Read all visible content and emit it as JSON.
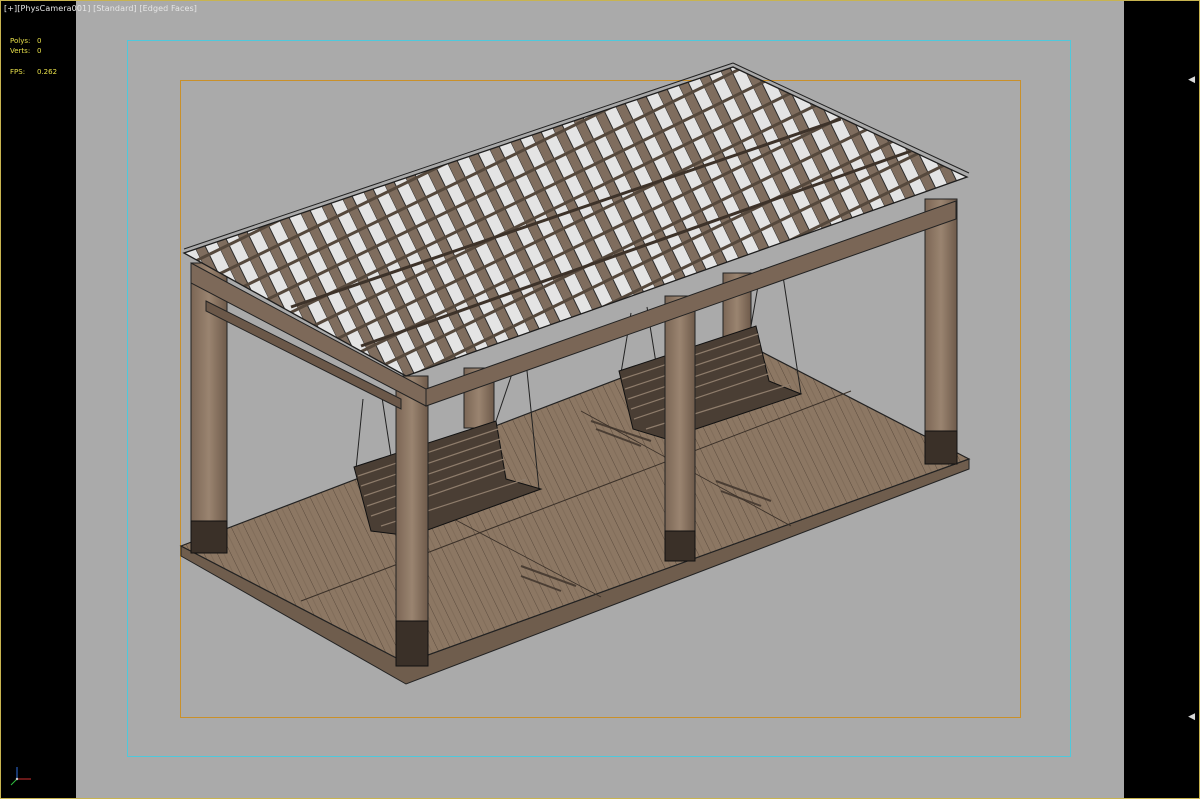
{
  "viewport": {
    "plus_label": "[+]",
    "camera_label": "[PhysCamera001]",
    "shading_label": "[Standard]",
    "display_label": "[Edged Faces]"
  },
  "stats": {
    "polys_label": "Polys:",
    "polys_value": "0",
    "verts_label": "Verts:",
    "verts_value": "0",
    "fps_label": "FPS:",
    "fps_value": "0.262"
  },
  "colors": {
    "safe_frame_outer": "#4fc9dc",
    "safe_frame_inner": "#c9902a",
    "wood": "#8a7561",
    "background": "#aaaaaa"
  },
  "icons": {
    "expand_arrow": "left-pointing-triangle",
    "axis_gizmo": "xyz-axis-tripod"
  }
}
